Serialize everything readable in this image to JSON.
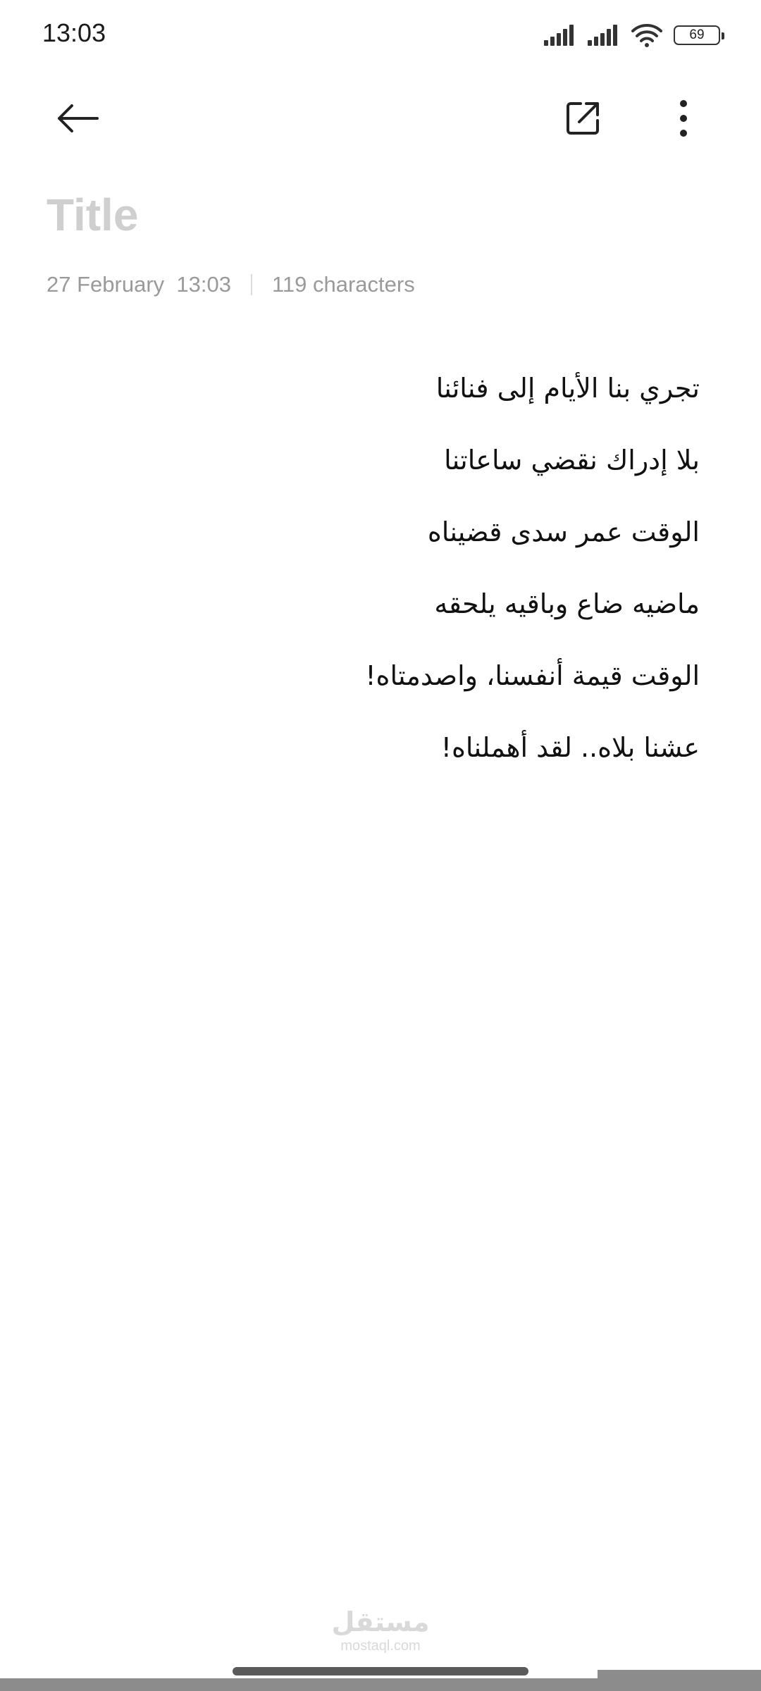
{
  "status_bar": {
    "time": "13:03",
    "battery_level": "69",
    "icons": [
      "signal-icon",
      "signal-icon",
      "wifi-icon",
      "battery-icon"
    ]
  },
  "toolbar": {
    "icons": [
      "back-arrow-icon",
      "share-icon",
      "more-vert-icon"
    ]
  },
  "note": {
    "title_placeholder": "Title",
    "date": "27 February  13:03",
    "char_count": "119 characters",
    "lines": [
      "تجري بنا الأيام إلى فنائنا",
      "بلا إدراك نقضي ساعاتنا",
      "الوقت عمر سدى قضيناه",
      "ماضيه ضاع وباقيه يلحقه",
      "الوقت قيمة أنفسنا، واصدمتاه!",
      "عشنا بلاه.. لقد أهملناه!"
    ]
  },
  "watermark": {
    "logo": "مستقل",
    "url": "mostaql.com"
  }
}
